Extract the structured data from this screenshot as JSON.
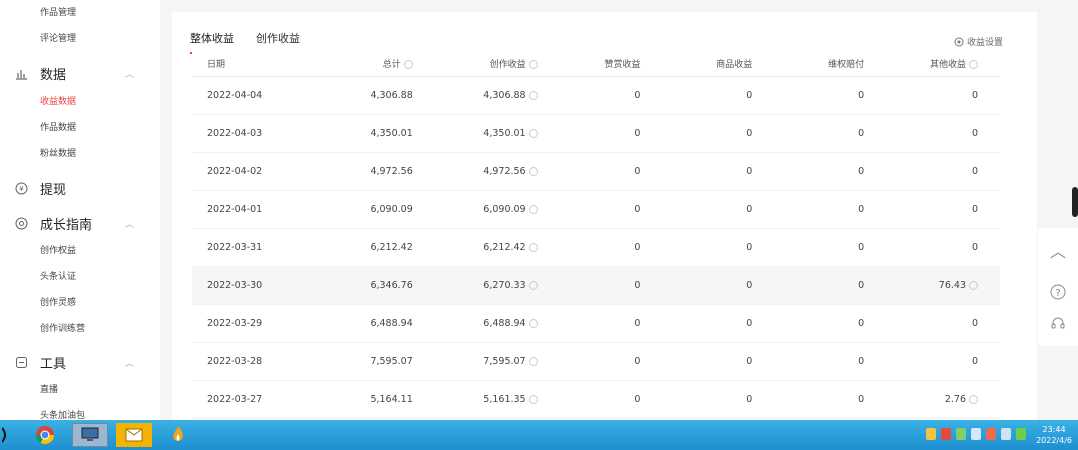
{
  "sidebar": {
    "top_items": [
      "作品管理",
      "评论管理"
    ],
    "groups": [
      {
        "label": "数据",
        "icon": "bar-chart-icon",
        "items": [
          "收益数据",
          "作品数据",
          "粉丝数据"
        ]
      },
      {
        "label": "提现",
        "icon": "withdraw-icon",
        "items": []
      },
      {
        "label": "成长指南",
        "icon": "growth-icon",
        "items": [
          "创作权益",
          "头条认证",
          "创作灵感",
          "创作训练营"
        ]
      },
      {
        "label": "工具",
        "icon": "tools-icon",
        "items": [
          "直播",
          "头条加油包"
        ]
      }
    ],
    "active_item": "收益数据"
  },
  "tabs": [
    "整体收益",
    "创作收益"
  ],
  "active_tab": "整体收益",
  "settings_label": "收益设置",
  "table": {
    "headers": [
      "日期",
      "总计",
      "创作收益",
      "赞赏收益",
      "商品收益",
      "维权赔付",
      "其他收益"
    ],
    "rows": [
      [
        "2022-04-04",
        "4,306.88",
        "4,306.88",
        "0",
        "0",
        "0",
        "0"
      ],
      [
        "2022-04-03",
        "4,350.01",
        "4,350.01",
        "0",
        "0",
        "0",
        "0"
      ],
      [
        "2022-04-02",
        "4,972.56",
        "4,972.56",
        "0",
        "0",
        "0",
        "0"
      ],
      [
        "2022-04-01",
        "6,090.09",
        "6,090.09",
        "0",
        "0",
        "0",
        "0"
      ],
      [
        "2022-03-31",
        "6,212.42",
        "6,212.42",
        "0",
        "0",
        "0",
        "0"
      ],
      [
        "2022-03-30",
        "6,346.76",
        "6,270.33",
        "0",
        "0",
        "0",
        "76.43"
      ],
      [
        "2022-03-29",
        "6,488.94",
        "6,488.94",
        "0",
        "0",
        "0",
        "0"
      ],
      [
        "2022-03-28",
        "7,595.07",
        "7,595.07",
        "0",
        "0",
        "0",
        "0"
      ],
      [
        "2022-03-27",
        "5,164.11",
        "5,161.35",
        "0",
        "0",
        "0",
        "2.76"
      ]
    ]
  },
  "taskbar": {
    "time": "23:44",
    "date": "2022/4/6",
    "apps": [
      "chrome-icon",
      "computer-icon",
      "mail-app-icon",
      "flame-app-icon"
    ]
  },
  "colors": {
    "accent": "#f04142",
    "taskbar": "#2a9fdb"
  }
}
